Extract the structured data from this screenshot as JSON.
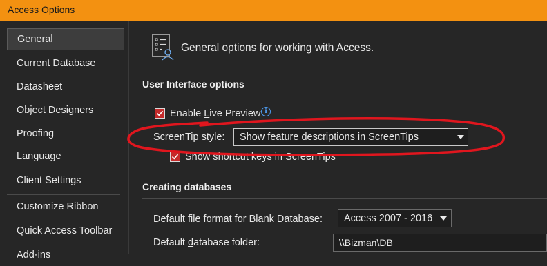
{
  "window": {
    "title": "Access Options"
  },
  "sidebar": {
    "items": [
      {
        "label": "General",
        "selected": true
      },
      {
        "label": "Current Database"
      },
      {
        "label": "Datasheet"
      },
      {
        "label": "Object Designers"
      },
      {
        "label": "Proofing"
      },
      {
        "label": "Language"
      },
      {
        "label": "Client Settings"
      },
      {
        "label": "Customize Ribbon"
      },
      {
        "label": "Quick Access Toolbar"
      },
      {
        "label": "Add-ins"
      }
    ]
  },
  "header": {
    "text": "General options for working with Access."
  },
  "ui_options": {
    "title": "User Interface options",
    "live_preview": {
      "pre": "Enable ",
      "u": "L",
      "post": "ive Preview",
      "checked": true
    },
    "screentip": {
      "label_pre": "Scr",
      "label_u": "e",
      "label_post": "enTip style:",
      "value": "Show feature descriptions in ScreenTips"
    },
    "shortcut_keys": {
      "pre": "Show s",
      "u": "h",
      "post": "ortcut keys in ScreenTips",
      "checked": true
    }
  },
  "creating": {
    "title": "Creating databases",
    "file_format": {
      "label_pre": "Default ",
      "label_u": "f",
      "label_post": "ile format for Blank Database:",
      "value": "Access 2007 - 2016"
    },
    "folder": {
      "label_pre": "Default ",
      "label_u": "d",
      "label_post": "atabase folder:",
      "value": "\\\\Bizman\\DB"
    }
  },
  "colors": {
    "titlebar": "#f39111",
    "checkbox": "#c42b2b",
    "annotation": "#e0161e",
    "info": "#4d9bf0"
  }
}
